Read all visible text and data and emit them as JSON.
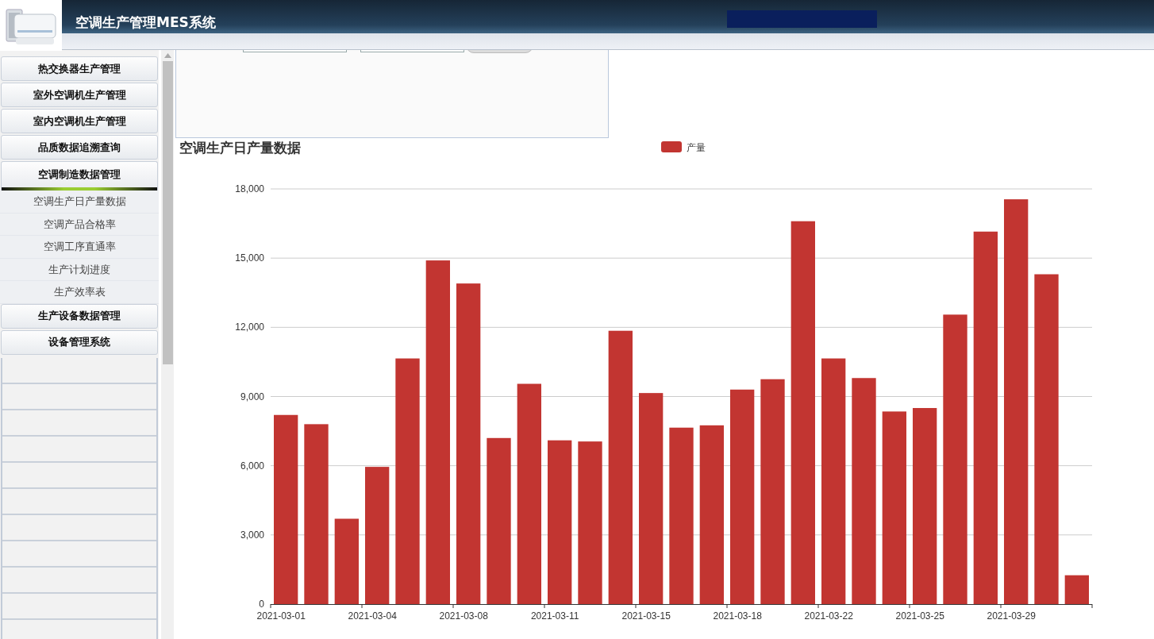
{
  "header": {
    "title": "空调生产管理MES系统"
  },
  "sidebar": {
    "groups": [
      {
        "label": "热交换器生产管理",
        "expanded": false
      },
      {
        "label": "室外空调机生产管理",
        "expanded": false
      },
      {
        "label": "室内空调机生产管理",
        "expanded": false
      },
      {
        "label": "品质数据追溯查询",
        "expanded": false
      },
      {
        "label": "空调制造数据管理",
        "expanded": true,
        "children": [
          {
            "label": "空调生产日产量数据"
          },
          {
            "label": "空调产品合格率"
          },
          {
            "label": "空调工序直通率"
          },
          {
            "label": "生产计划进度"
          },
          {
            "label": "生产效率表"
          }
        ]
      },
      {
        "label": "生产设备数据管理",
        "expanded": false
      },
      {
        "label": "设备管理系统",
        "expanded": false
      }
    ]
  },
  "chart_data": {
    "type": "bar",
    "title": "空调生产日产量数据",
    "grid": true,
    "categories": [
      "2021-03-01",
      null,
      null,
      "2021-03-04",
      null,
      null,
      "2021-03-08",
      null,
      null,
      "2021-03-11",
      null,
      null,
      "2021-03-15",
      null,
      null,
      "2021-03-18",
      null,
      null,
      "2021-03-22",
      null,
      null,
      "2021-03-25",
      null,
      null,
      "2021-03-29",
      null,
      null
    ],
    "series": [
      {
        "name": "产量",
        "color": "#c23531",
        "values": [
          8200,
          7800,
          3700,
          5950,
          10650,
          14900,
          13900,
          7200,
          9550,
          7100,
          7050,
          11850,
          9150,
          7650,
          7750,
          9300,
          9750,
          16600,
          10650,
          9800,
          8350,
          8500,
          12550,
          16150,
          17550,
          14300,
          1250
        ]
      }
    ],
    "ylim": [
      0,
      18000
    ],
    "yticks": [
      {
        "value": 0,
        "label": "0"
      },
      {
        "value": 3000,
        "label": "3,000"
      },
      {
        "value": 6000,
        "label": "6,000"
      },
      {
        "value": 9000,
        "label": "9,000"
      },
      {
        "value": 12000,
        "label": "12,000"
      },
      {
        "value": 15000,
        "label": "15,000"
      },
      {
        "value": 18000,
        "label": "18,000"
      }
    ]
  }
}
